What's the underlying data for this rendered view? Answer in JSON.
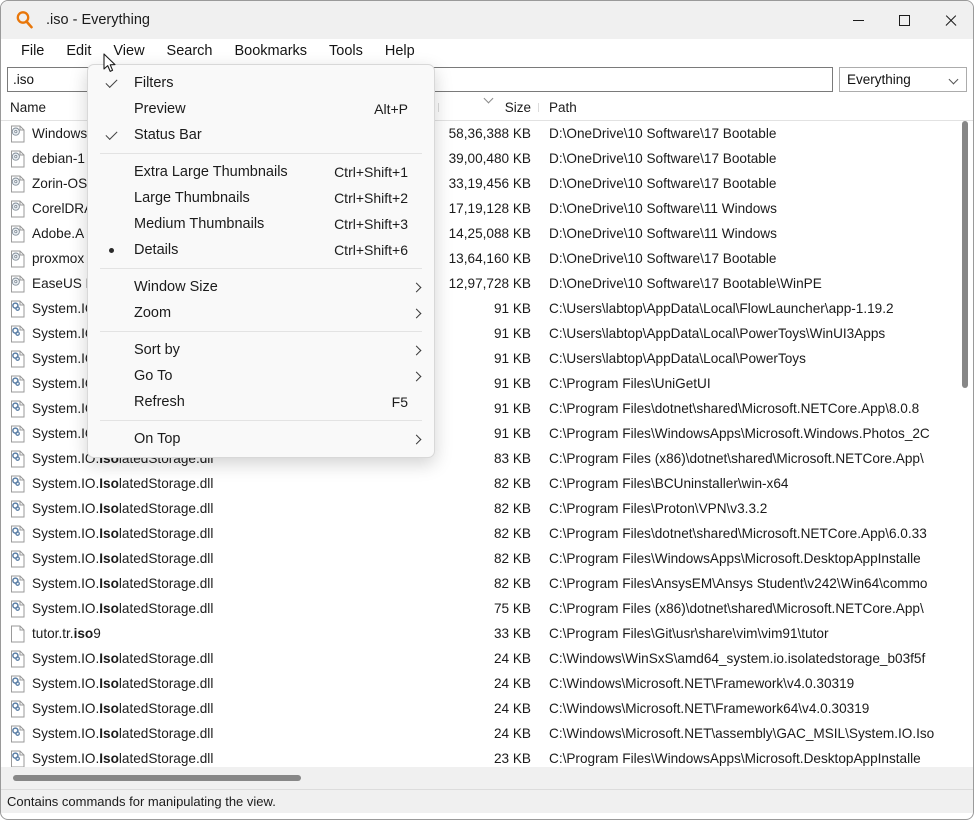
{
  "window": {
    "title": ".iso - Everything",
    "app_icon": "magnifier-icon",
    "minimize_label": "Minimize",
    "maximize_label": "Maximize",
    "close_label": "Close"
  },
  "menubar": {
    "items": [
      {
        "label": "File"
      },
      {
        "label": "Edit"
      },
      {
        "label": "View"
      },
      {
        "label": "Search"
      },
      {
        "label": "Bookmarks"
      },
      {
        "label": "Tools"
      },
      {
        "label": "Help"
      }
    ],
    "active": "View"
  },
  "search": {
    "value": ".iso",
    "placeholder": "",
    "secondary_value": "",
    "secondary_placeholder": "",
    "scope_selected": "Everything"
  },
  "view_menu": {
    "items": [
      {
        "label": "Filters",
        "accel": "",
        "check": "tick",
        "submenu": false
      },
      {
        "label": "Preview",
        "accel": "Alt+P",
        "check": "",
        "submenu": false
      },
      {
        "label": "Status Bar",
        "accel": "",
        "check": "tick",
        "submenu": false
      },
      {
        "separator": true
      },
      {
        "label": "Extra Large Thumbnails",
        "accel": "Ctrl+Shift+1",
        "check": "",
        "submenu": false
      },
      {
        "label": "Large Thumbnails",
        "accel": "Ctrl+Shift+2",
        "check": "",
        "submenu": false
      },
      {
        "label": "Medium Thumbnails",
        "accel": "Ctrl+Shift+3",
        "check": "",
        "submenu": false
      },
      {
        "label": "Details",
        "accel": "Ctrl+Shift+6",
        "check": "bullet",
        "submenu": false
      },
      {
        "separator": true
      },
      {
        "label": "Window Size",
        "accel": "",
        "check": "",
        "submenu": true
      },
      {
        "label": "Zoom",
        "accel": "",
        "check": "",
        "submenu": true
      },
      {
        "separator": true
      },
      {
        "label": "Sort by",
        "accel": "",
        "check": "",
        "submenu": true
      },
      {
        "label": "Go To",
        "accel": "",
        "check": "",
        "submenu": true
      },
      {
        "label": "Refresh",
        "accel": "F5",
        "check": "",
        "submenu": false
      },
      {
        "separator": true
      },
      {
        "label": "On Top",
        "accel": "",
        "check": "",
        "submenu": true
      }
    ]
  },
  "columns": {
    "name": "Name",
    "size": "Size",
    "path": "Path",
    "sorted_by": "Size",
    "sort_direction": "descending"
  },
  "rows": [
    {
      "icon": "iso-disc-icon",
      "name_pre": "Windows",
      "name_match": "",
      "name_post": "",
      "size": "58,36,388 KB",
      "path": "D:\\OneDrive\\10 Software\\17 Bootable"
    },
    {
      "icon": "iso-disc-icon",
      "name_pre": "debian-1",
      "name_match": "",
      "name_post": "",
      "size": "39,00,480 KB",
      "path": "D:\\OneDrive\\10 Software\\17 Bootable"
    },
    {
      "icon": "iso-disc-icon",
      "name_pre": "Zorin-OS",
      "name_match": "",
      "name_post": "",
      "size": "33,19,456 KB",
      "path": "D:\\OneDrive\\10 Software\\17 Bootable"
    },
    {
      "icon": "iso-disc-icon",
      "name_pre": "CorelDRA",
      "name_match": "",
      "name_post": "",
      "size": "17,19,128 KB",
      "path": "D:\\OneDrive\\10 Software\\11 Windows"
    },
    {
      "icon": "iso-disc-icon",
      "name_pre": "Adobe.A",
      "name_match": "",
      "name_post": "",
      "size": "14,25,088 KB",
      "path": "D:\\OneDrive\\10 Software\\11 Windows"
    },
    {
      "icon": "iso-disc-icon",
      "name_pre": "proxmox",
      "name_match": "",
      "name_post": "",
      "size": "13,64,160 KB",
      "path": "D:\\OneDrive\\10 Software\\17 Bootable"
    },
    {
      "icon": "iso-disc-icon",
      "name_pre": "EaseUS P",
      "name_match": "",
      "name_post": "",
      "size": "12,97,728 KB",
      "path": "D:\\OneDrive\\10 Software\\17 Bootable\\WinPE"
    },
    {
      "icon": "dll-gear-icon",
      "name_pre": "System.IO",
      "name_match": "",
      "name_post": "",
      "size": "91 KB",
      "path": "C:\\Users\\labtop\\AppData\\Local\\FlowLauncher\\app-1.19.2"
    },
    {
      "icon": "dll-gear-icon",
      "name_pre": "System.IO",
      "name_match": "",
      "name_post": "",
      "size": "91 KB",
      "path": "C:\\Users\\labtop\\AppData\\Local\\PowerToys\\WinUI3Apps"
    },
    {
      "icon": "dll-gear-icon",
      "name_pre": "System.IO",
      "name_match": "",
      "name_post": "",
      "size": "91 KB",
      "path": "C:\\Users\\labtop\\AppData\\Local\\PowerToys"
    },
    {
      "icon": "dll-gear-icon",
      "name_pre": "System.IO",
      "name_match": "",
      "name_post": "",
      "size": "91 KB",
      "path": "C:\\Program Files\\UniGetUI"
    },
    {
      "icon": "dll-gear-icon",
      "name_pre": "System.IO",
      "name_match": "",
      "name_post": "",
      "size": "91 KB",
      "path": "C:\\Program Files\\dotnet\\shared\\Microsoft.NETCore.App\\8.0.8"
    },
    {
      "icon": "dll-gear-icon",
      "name_pre": "System.IO",
      "name_match": "",
      "name_post": "",
      "size": "91 KB",
      "path": "C:\\Program Files\\WindowsApps\\Microsoft.Windows.Photos_2C"
    },
    {
      "icon": "dll-gear-icon",
      "name_pre": "System.IO.",
      "name_match": "Iso",
      "name_post": "latedStorage.dll",
      "size": "83 KB",
      "path": "C:\\Program Files (x86)\\dotnet\\shared\\Microsoft.NETCore.App\\"
    },
    {
      "icon": "dll-gear-icon",
      "name_pre": "System.IO.",
      "name_match": "Iso",
      "name_post": "latedStorage.dll",
      "size": "82 KB",
      "path": "C:\\Program Files\\BCUninstaller\\win-x64"
    },
    {
      "icon": "dll-gear-icon",
      "name_pre": "System.IO.",
      "name_match": "Iso",
      "name_post": "latedStorage.dll",
      "size": "82 KB",
      "path": "C:\\Program Files\\Proton\\VPN\\v3.3.2"
    },
    {
      "icon": "dll-gear-icon",
      "name_pre": "System.IO.",
      "name_match": "Iso",
      "name_post": "latedStorage.dll",
      "size": "82 KB",
      "path": "C:\\Program Files\\dotnet\\shared\\Microsoft.NETCore.App\\6.0.33"
    },
    {
      "icon": "dll-gear-icon",
      "name_pre": "System.IO.",
      "name_match": "Iso",
      "name_post": "latedStorage.dll",
      "size": "82 KB",
      "path": "C:\\Program Files\\WindowsApps\\Microsoft.DesktopAppInstalle"
    },
    {
      "icon": "dll-gear-icon",
      "name_pre": "System.IO.",
      "name_match": "Iso",
      "name_post": "latedStorage.dll",
      "size": "82 KB",
      "path": "C:\\Program Files\\AnsysEM\\Ansys Student\\v242\\Win64\\commo"
    },
    {
      "icon": "dll-gear-icon",
      "name_pre": "System.IO.",
      "name_match": "Iso",
      "name_post": "latedStorage.dll",
      "size": "75 KB",
      "path": "C:\\Program Files (x86)\\dotnet\\shared\\Microsoft.NETCore.App\\"
    },
    {
      "icon": "plain-file-icon",
      "name_pre": "tutor.tr.",
      "name_match": "iso",
      "name_post": "9",
      "size": "33 KB",
      "path": "C:\\Program Files\\Git\\usr\\share\\vim\\vim91\\tutor"
    },
    {
      "icon": "dll-gear-icon",
      "name_pre": "System.IO.",
      "name_match": "Iso",
      "name_post": "latedStorage.dll",
      "size": "24 KB",
      "path": "C:\\Windows\\WinSxS\\amd64_system.io.isolatedstorage_b03f5f"
    },
    {
      "icon": "dll-gear-icon",
      "name_pre": "System.IO.",
      "name_match": "Iso",
      "name_post": "latedStorage.dll",
      "size": "24 KB",
      "path": "C:\\Windows\\Microsoft.NET\\Framework\\v4.0.30319"
    },
    {
      "icon": "dll-gear-icon",
      "name_pre": "System.IO.",
      "name_match": "Iso",
      "name_post": "latedStorage.dll",
      "size": "24 KB",
      "path": "C:\\Windows\\Microsoft.NET\\Framework64\\v4.0.30319"
    },
    {
      "icon": "dll-gear-icon",
      "name_pre": "System.IO.",
      "name_match": "Iso",
      "name_post": "latedStorage.dll",
      "size": "24 KB",
      "path": "C:\\Windows\\Microsoft.NET\\assembly\\GAC_MSIL\\System.IO.Iso"
    },
    {
      "icon": "dll-gear-icon",
      "name_pre": "System.IO.",
      "name_match": "Iso",
      "name_post": "latedStorage.dll",
      "size": "23 KB",
      "path": "C:\\Program Files\\WindowsApps\\Microsoft.DesktopAppInstalle"
    }
  ],
  "statusbar": {
    "text": "Contains commands for manipulating the view."
  },
  "colors": {
    "accent": "#E8770B",
    "window_bg": "#ffffff",
    "chrome_bg": "#f0f0f0",
    "menu_bg": "#f9f9f9",
    "scrollbar": "#878787"
  }
}
